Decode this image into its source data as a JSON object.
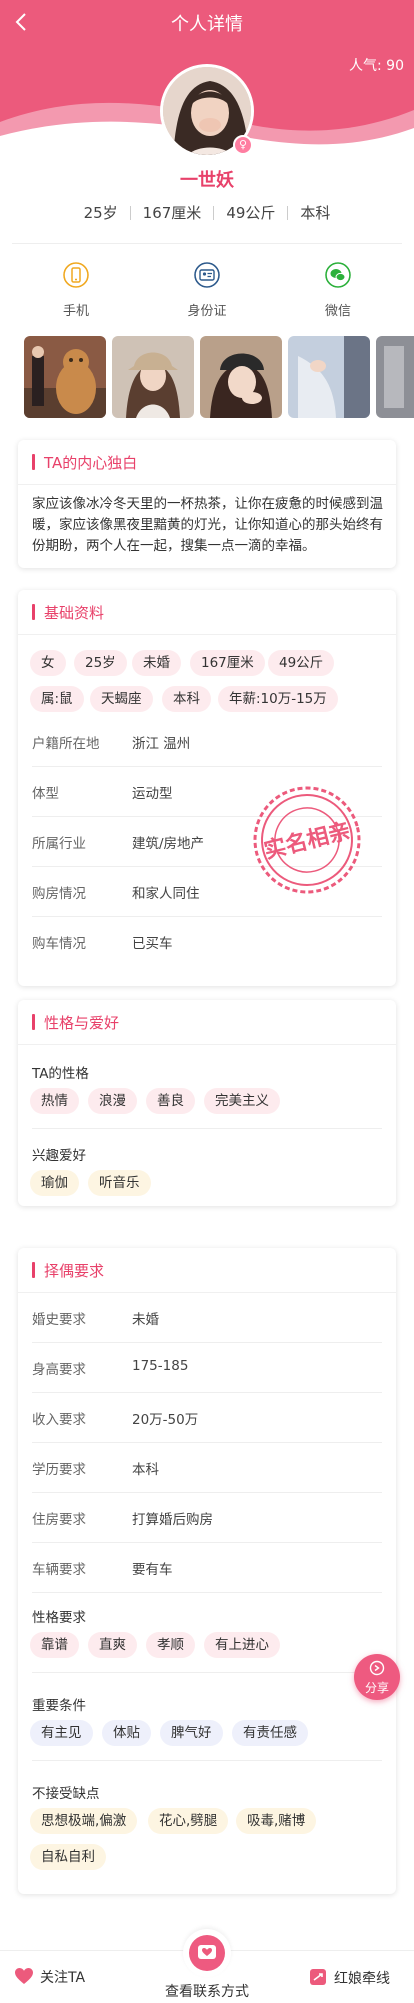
{
  "nav": {
    "title": "个人详情",
    "popularity": "人气: 90"
  },
  "profile": {
    "name": "一世妖",
    "gender_symbol": "♀",
    "stats": [
      "25岁",
      "167厘米",
      "49公斤",
      "本科"
    ]
  },
  "contacts": [
    {
      "label": "手机",
      "icon": "phone-icon",
      "color": "#f0a820"
    },
    {
      "label": "身份证",
      "icon": "id-card-icon",
      "color": "#2d5a8c"
    },
    {
      "label": "微信",
      "icon": "wechat-icon",
      "color": "#2bb03a"
    }
  ],
  "photos": [
    "photo-1",
    "photo-2",
    "photo-3",
    "photo-4"
  ],
  "monologue": {
    "title": "TA的内心独白",
    "text": "家应该像冰冷冬天里的一杯热茶，让你在疲惫的时候感到温暖，家应该像黑夜里黯黄的灯光，让你知道心的那头始终有份期盼，两个人在一起，搜集一点一滴的幸福。"
  },
  "basic": {
    "title": "基础资料",
    "tags_row1": [
      "女",
      "25岁",
      "未婚",
      "167厘米",
      "49公斤"
    ],
    "tags_row2": [
      "属:鼠",
      "天蝎座",
      "本科",
      "年薪:10万-15万"
    ],
    "rows": [
      {
        "k": "户籍所在地",
        "v": "浙江 温州"
      },
      {
        "k": "体型",
        "v": "运动型"
      },
      {
        "k": "所属行业",
        "v": "建筑/房地产"
      },
      {
        "k": "购房情况",
        "v": "和家人同住"
      },
      {
        "k": "购车情况",
        "v": "已买车"
      }
    ],
    "stamp": "实名相亲"
  },
  "hobby": {
    "title": "性格与爱好",
    "personality_label": "TA的性格",
    "personality": [
      "热情",
      "浪漫",
      "善良",
      "完美主义"
    ],
    "interest_label": "兴趣爱好",
    "interests": [
      "瑜伽",
      "听音乐"
    ]
  },
  "partner": {
    "title": "择偶要求",
    "rows": [
      {
        "k": "婚史要求",
        "v": "未婚"
      },
      {
        "k": "身高要求",
        "v": "175-185"
      },
      {
        "k": "收入要求",
        "v": "20万-50万"
      },
      {
        "k": "学历要求",
        "v": "本科"
      },
      {
        "k": "住房要求",
        "v": "打算婚后购房"
      },
      {
        "k": "车辆要求",
        "v": "要有车"
      }
    ],
    "personality_label": "性格要求",
    "personality": [
      "靠谱",
      "直爽",
      "孝顺",
      "有上进心"
    ],
    "important_label": "重要条件",
    "important": [
      "有主见",
      "体贴",
      "脾气好",
      "有责任感"
    ],
    "reject_label": "不接受缺点",
    "reject": [
      "思想极端,偏激",
      "花心,劈腿",
      "吸毒,赌博",
      "自私自利"
    ]
  },
  "share_label": "分享",
  "bottom": {
    "follow": "关注TA",
    "contact": "查看联系方式",
    "matchmaker": "红娘牵线"
  },
  "colors": {
    "brand": "#ec5a7c",
    "accent": "#e8416a"
  }
}
